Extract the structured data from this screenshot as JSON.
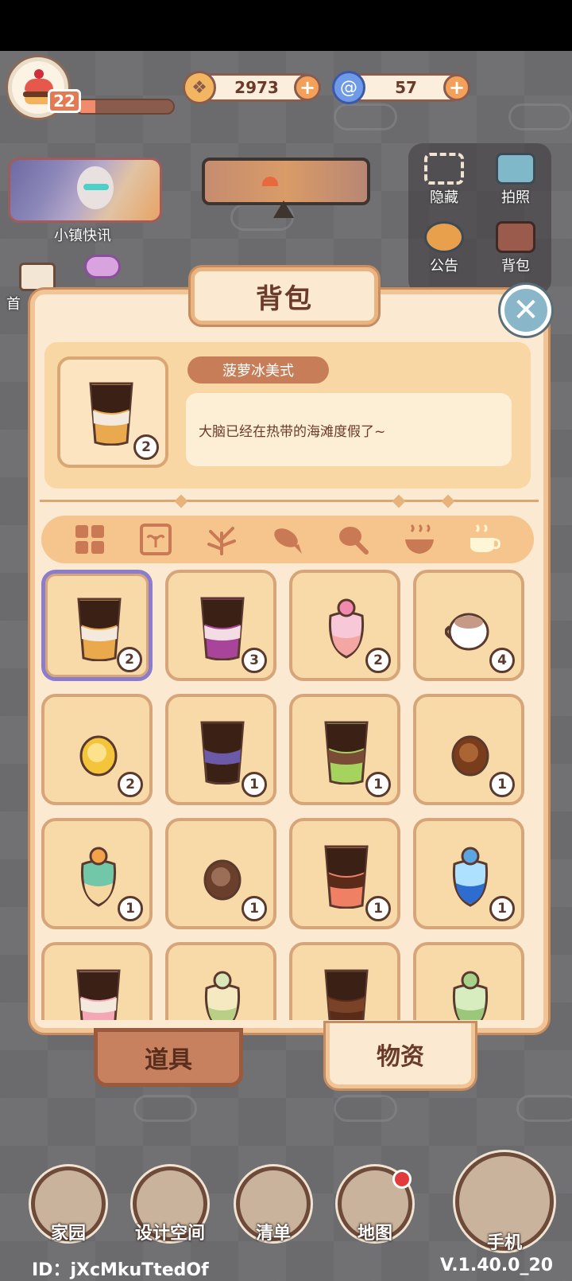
{
  "hud": {
    "level": "22",
    "xp_progress": 0.2,
    "coins": "2973",
    "gems": "57",
    "news_label": "小镇快讯",
    "home_label_partial": "首"
  },
  "right_tools": [
    {
      "label": "隐藏",
      "icon": "hide-icon"
    },
    {
      "label": "拍照",
      "icon": "camera-icon"
    },
    {
      "label": "公告",
      "icon": "announcement-icon"
    },
    {
      "label": "背包",
      "icon": "backpack-icon"
    }
  ],
  "bag": {
    "title": "背包",
    "selected_item": {
      "name": "菠萝冰美式",
      "description": "大脑已经在热带的海滩度假了~",
      "count": "2"
    },
    "categories": [
      {
        "id": "all",
        "icon": "grid-icon",
        "active": false
      },
      {
        "id": "seeds",
        "icon": "seed-packet-icon",
        "active": false
      },
      {
        "id": "plants",
        "icon": "sprout-icon",
        "active": false
      },
      {
        "id": "fish",
        "icon": "fish-icon",
        "active": false
      },
      {
        "id": "meat",
        "icon": "drumstick-icon",
        "active": false
      },
      {
        "id": "dishes",
        "icon": "bowl-icon",
        "active": false
      },
      {
        "id": "drinks",
        "icon": "cup-icon",
        "active": true
      }
    ],
    "items": [
      {
        "kind": "cup",
        "colors": [
          "#3b2016",
          "#f3e9dc",
          "#e9a94c"
        ],
        "count": "2",
        "selected": true
      },
      {
        "kind": "cup",
        "colors": [
          "#3b2016",
          "#f3dde4",
          "#a9449b"
        ],
        "count": "3",
        "selected": false
      },
      {
        "kind": "fancy",
        "colors": [
          "#f28ab0",
          "#f7c9d8",
          "#f4a7a2"
        ],
        "count": "2",
        "selected": false
      },
      {
        "kind": "mug",
        "colors": [
          "#ffffff",
          "#c69a86"
        ],
        "count": "4",
        "selected": false
      },
      {
        "kind": "orb",
        "colors": [
          "#f4c53b",
          "#ffe9a4"
        ],
        "count": "2",
        "selected": false
      },
      {
        "kind": "cup",
        "colors": [
          "#3b2016",
          "#6b5aa8",
          "#3b2016"
        ],
        "count": "1",
        "selected": false
      },
      {
        "kind": "cup",
        "colors": [
          "#3b2016",
          "#7a4b35",
          "#a6d35d"
        ],
        "count": "1",
        "selected": false
      },
      {
        "kind": "orb",
        "colors": [
          "#7a3d1c",
          "#b86f3b"
        ],
        "count": "1",
        "selected": false
      },
      {
        "kind": "fancy",
        "colors": [
          "#f3a24b",
          "#72c7a8",
          "#f7d7a1"
        ],
        "count": "1",
        "selected": false
      },
      {
        "kind": "orb",
        "colors": [
          "#6a3f2c",
          "#a77b63"
        ],
        "count": "1",
        "selected": false
      },
      {
        "kind": "cup",
        "colors": [
          "#3b2016",
          "#5a2b18",
          "#f08064"
        ],
        "count": "1",
        "selected": false
      },
      {
        "kind": "fancy",
        "colors": [
          "#5ba6e0",
          "#aee0ff",
          "#2f6cd0"
        ],
        "count": "1",
        "selected": false
      },
      {
        "kind": "cup",
        "colors": [
          "#3b2016",
          "#f3e9dc",
          "#f4a7b5"
        ],
        "count": "",
        "selected": false
      },
      {
        "kind": "fancy",
        "colors": [
          "#d9e6b7",
          "#f5e9c2",
          "#b9cf85"
        ],
        "count": "",
        "selected": false
      },
      {
        "kind": "cup",
        "colors": [
          "#3b2016",
          "#7a4226",
          "#5a2b18"
        ],
        "count": "",
        "selected": false
      },
      {
        "kind": "fancy",
        "colors": [
          "#a8d28a",
          "#d7edc0",
          "#9bc77b"
        ],
        "count": "",
        "selected": false
      }
    ],
    "tabs": [
      {
        "label": "道具",
        "active": false
      },
      {
        "label": "物资",
        "active": true
      }
    ]
  },
  "bottom_nav": [
    {
      "label": "家园",
      "icon": "house-icon"
    },
    {
      "label": "设计空间",
      "icon": "ruler-icon"
    },
    {
      "label": "清单",
      "icon": "list-icon"
    },
    {
      "label": "地图",
      "icon": "map-pin-icon",
      "badge": true
    },
    {
      "label": "手机",
      "icon": "phone-icon"
    }
  ],
  "footer": {
    "user_id": "ID：jXcMkuTtedOf",
    "version": "V.1.40.0_20"
  },
  "colors": {
    "panel_bg": "#fbe9d1",
    "panel_border": "#f0c495",
    "accent": "#c77e58",
    "selected_outline": "#8b7ccc",
    "text_brown": "#6a3b2b"
  }
}
